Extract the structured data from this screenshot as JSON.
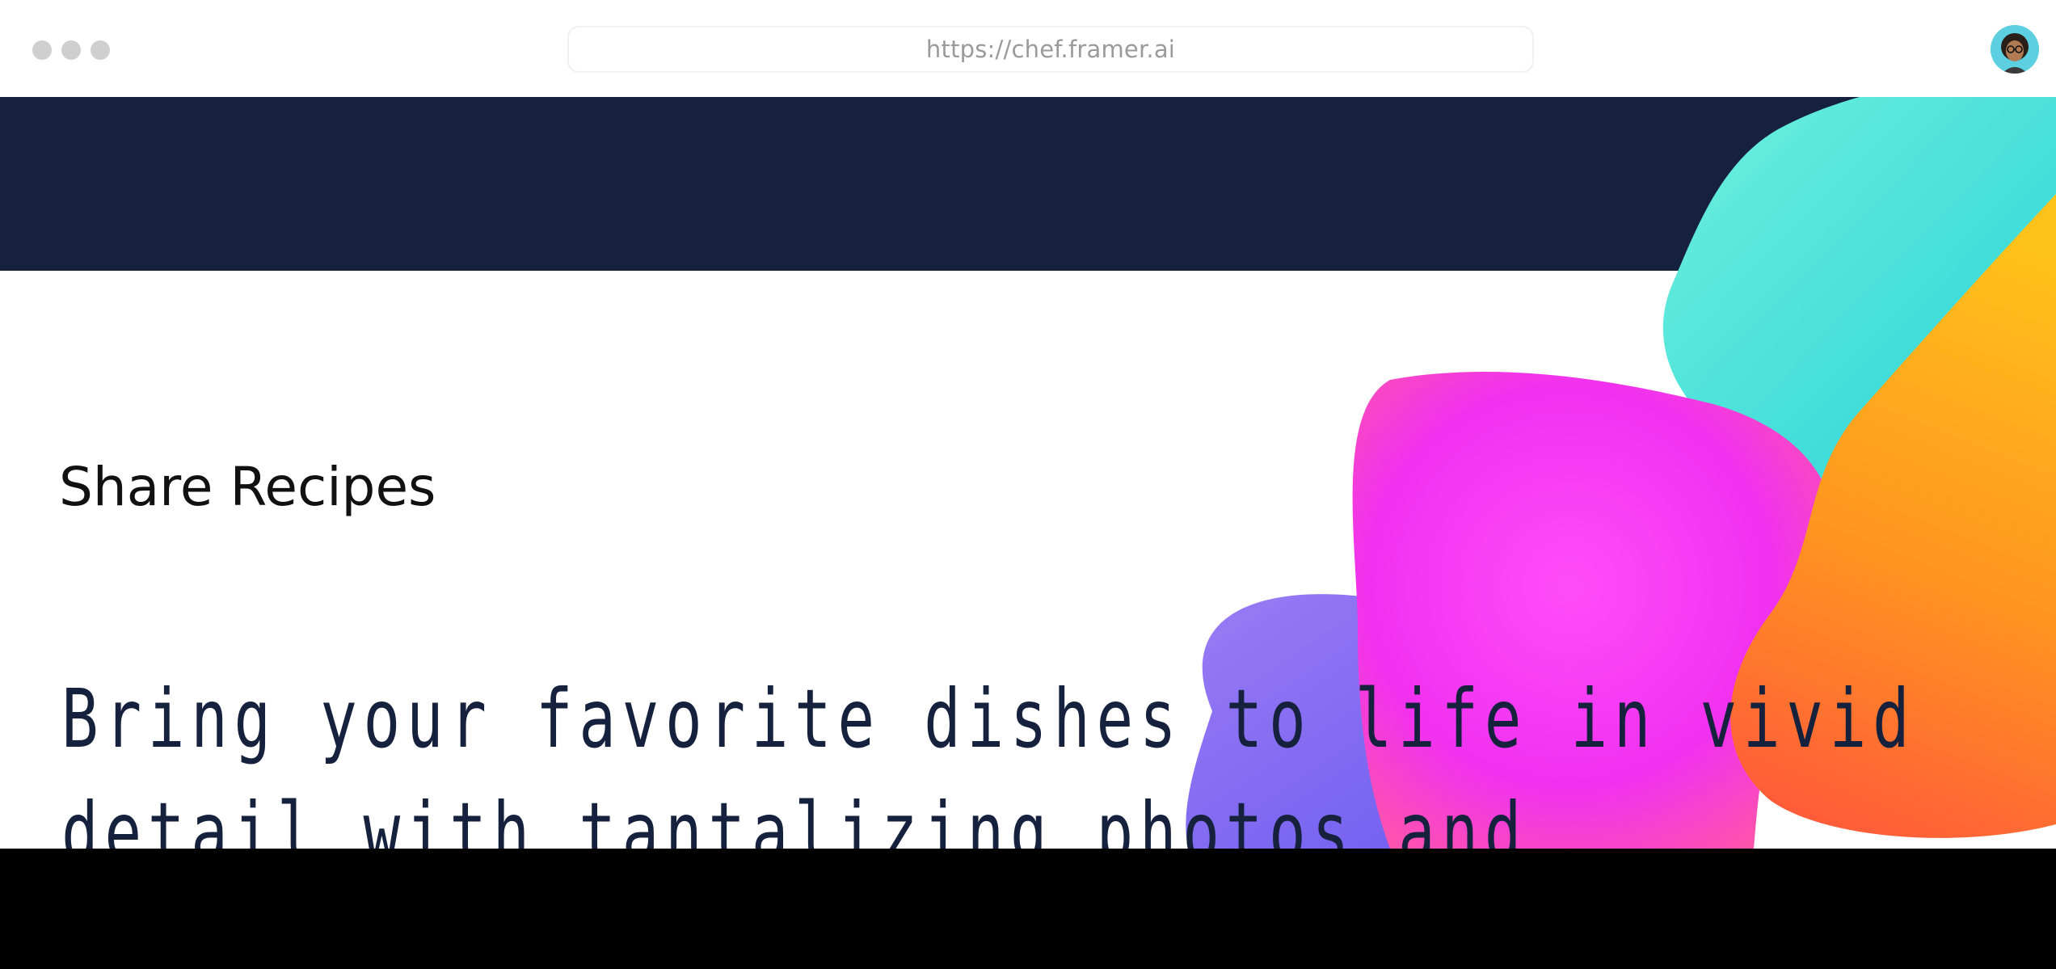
{
  "browser": {
    "url": "https://chef.framer.ai",
    "window_controls": [
      "close",
      "minimize",
      "maximize"
    ],
    "avatar_icon": "user-avatar-icon"
  },
  "hero": {
    "section_label": "Share Recipes",
    "headline_line1": "Bring your favorite dishes to life in vivid",
    "headline_line2": "detail with tantalizing photos and"
  },
  "colors": {
    "nav_band": "#16223d",
    "headline": "#16223d",
    "blob_teal": "#4fe3d8",
    "blob_orange": "#ff9a1f",
    "blob_pink": "#f23dff",
    "blob_purple": "#8a6cf0"
  }
}
